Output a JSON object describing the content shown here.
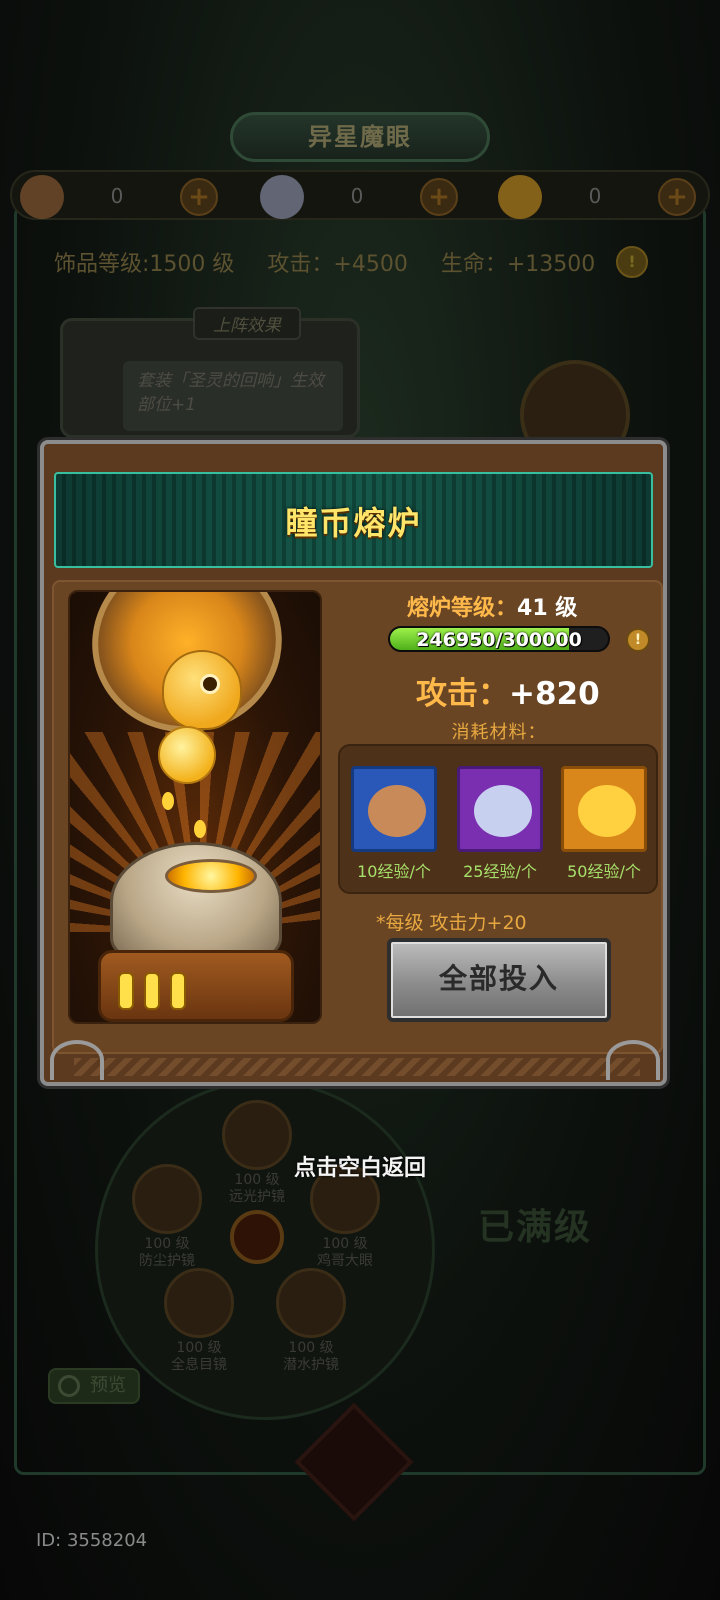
{
  "background": {
    "title": "异星魔眼",
    "currencies": [
      {
        "name": "bronze-coin-icon",
        "count": "0",
        "color": "#a0683a"
      },
      {
        "name": "silver-coin-icon",
        "count": "0",
        "color": "#a0a8c8"
      },
      {
        "name": "gold-coin-icon",
        "count": "0",
        "color": "#e0a020"
      }
    ],
    "stats": {
      "accessory_level": "饰品等级:1500 级",
      "attack": "攻击：+4500",
      "life": "生命：+13500"
    },
    "deploy_effect": {
      "tag": "上阵效果",
      "text": "套装「圣灵的回响」生效部位+1"
    },
    "wheel_slots": [
      {
        "level": "100 级",
        "name": "远光护镜"
      },
      {
        "level": "100 级",
        "name": "防尘护镜"
      },
      {
        "level": "100 级",
        "name": "鸡哥大眼"
      },
      {
        "level": "100 级",
        "name": "全息目镜"
      },
      {
        "level": "100 级",
        "name": "潜水护镜"
      }
    ],
    "maxed_label": "已满级",
    "preview_label": "预览",
    "id_text": "ID: 3558204"
  },
  "dialog": {
    "title": "瞳币熔炉",
    "furnace_level_label": "熔炉等级：",
    "furnace_level_value": "41 级",
    "progress_text": "246950/300000",
    "progress_fraction": 0.8232,
    "attack_label": "攻击：",
    "attack_value": "+820",
    "consume_label": "消耗材料：",
    "materials": [
      {
        "icon": "bronze-coin-icon",
        "exp": "10经验/个",
        "tile_color": "#2a58b8",
        "gem_color": "#c98a5a"
      },
      {
        "icon": "silver-coin-icon",
        "exp": "25经验/个",
        "tile_color": "#7a2fb0",
        "gem_color": "#c8d0f0"
      },
      {
        "icon": "gold-coin-icon",
        "exp": "50经验/个",
        "tile_color": "#d9861a",
        "gem_color": "#ffd040"
      }
    ],
    "note": "*每级 攻击力+20",
    "invest_all_label": "全部投入"
  },
  "hint": "点击空白返回"
}
